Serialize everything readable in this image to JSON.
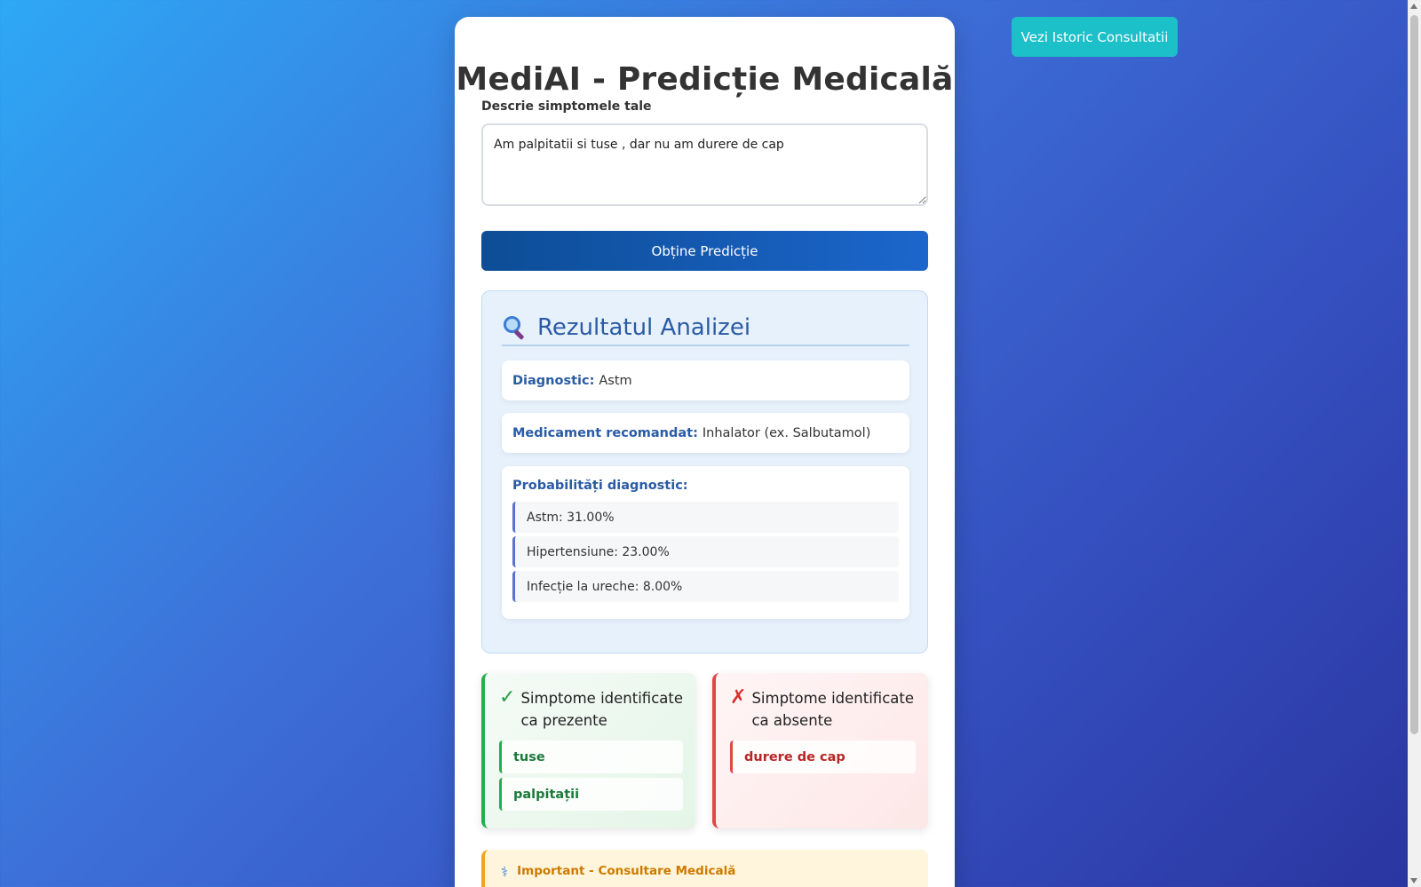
{
  "history_button": "Vezi Istoric Consultatii",
  "title": "MediAI - Predicție Medicală",
  "symptoms_label": "Descrie simptomele tale",
  "symptoms_value": "Am palpitatii si tuse , dar nu am durere de cap",
  "predict_button": "Obține Predicție",
  "result": {
    "title": "Rezultatul Analizei",
    "diagnostic_label": "Diagnostic:",
    "diagnostic_value": "Astm",
    "medication_label": "Medicament recomandat:",
    "medication_value": "Inhalator (ex. Salbutamol)",
    "probabilities_title": "Probabilități diagnostic:",
    "probabilities": [
      "Astm: 31.00%",
      "Hipertensiune: 23.00%",
      "Infecție la ureche: 8.00%"
    ]
  },
  "present": {
    "mark": "✓",
    "title": "Simptome identificate ca prezente",
    "items": [
      "tuse",
      "palpitații"
    ]
  },
  "absent": {
    "mark": "✗",
    "title": "Simptome identificate ca absente",
    "items": [
      "durere de cap"
    ]
  },
  "important": {
    "icon": "⚕",
    "title": "Important - Consultare Medicală"
  },
  "colors": {
    "accent": "#1cc0c8",
    "primary": "#0d4d96",
    "present": "#22b04a",
    "absent": "#e04848",
    "warning": "#f2a51c"
  }
}
